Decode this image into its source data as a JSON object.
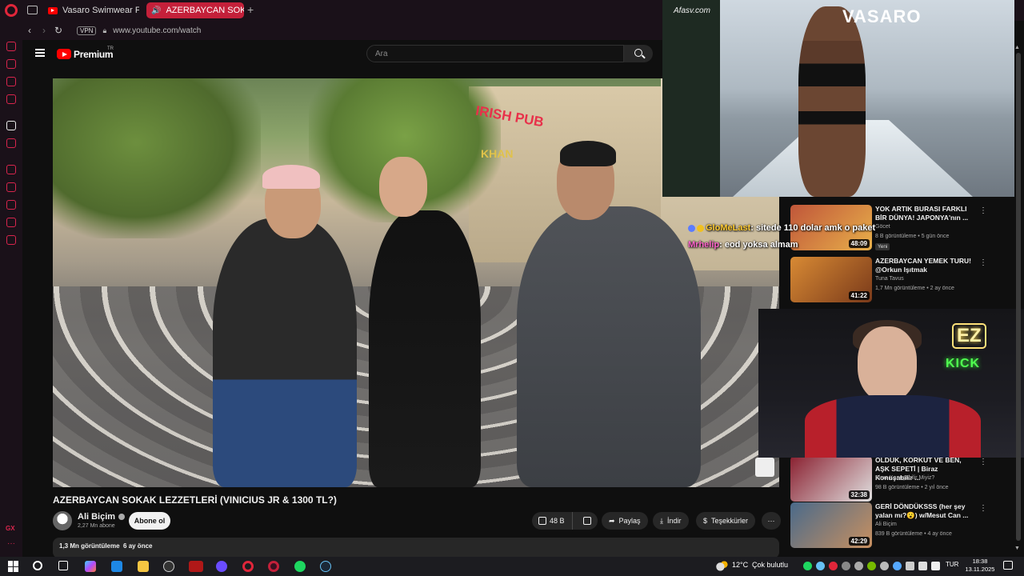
{
  "browser": {
    "tabs": [
      {
        "label": "Vasaro Swimwear Fashion"
      },
      {
        "label": "AZERBAYCAN SOKAK"
      }
    ],
    "vpn_label": "VPN",
    "url": "www.youtube.com/watch"
  },
  "youtube": {
    "brand": "Premium",
    "tm": "TR",
    "search_placeholder": "Ara"
  },
  "video": {
    "title": "AZERBAYCAN SOKAK LEZZETLERİ (VINICIUS JR & 1300 TL?)",
    "channel": "Ali Biçim",
    "subscribers": "2,27 Mn abone",
    "subscribe_label": "Abone ol",
    "likes": "48 B",
    "share_label": "Paylaş",
    "download_label": "İndir",
    "thanks_label": "Teşekkürler",
    "views": "1,3 Mn görüntüleme",
    "age": "6 ay önce",
    "scene_text": {
      "pub_sign": "IRISH PUB",
      "khan_sign": "KHAN"
    }
  },
  "recommendations": [
    {
      "title": "YOK ARTIK BURASI FARKLI BİR DÜNYA! JAPONYA'nın ...",
      "channel": "Göcet",
      "meta": "8 B görüntüleme • 5 gün önce",
      "badge": "Yeni",
      "duration": "48:09",
      "thumb_color": "#c0563a"
    },
    {
      "title": "AZERBAYCAN YEMEK TURU! @Orkun Işıtmak",
      "channel": "Tuna Tavus",
      "meta": "1,7 Mn görüntüleme • 2 ay önce",
      "duration": "41:22",
      "thumb_color": "#d88a34"
    },
    {
      "title": "ÖLDÜK, KORKUT VE BEN, AŞK SEPETİ | Biraz Konuşabilir ...",
      "channel": "Biraz Konuşabilir Miyiz?",
      "meta": "98 B görüntüleme • 2 yıl önce",
      "duration": "32:38",
      "thumb_color": "#8a2030"
    },
    {
      "title": "GERİ DÖNDÜKSSS (her şey yalan mı?😮) w/Mesut Can ...",
      "channel": "Ali Biçim",
      "meta": "839 B görüntüleme • 4 ay önce",
      "duration": "42:29",
      "thumb_color": "#4a6a8a"
    }
  ],
  "stream_overlay": {
    "runway_brand": "VASARO",
    "runway_watermark": "Afasv.com",
    "chat": [
      {
        "user": "GloMeLast",
        "message": ": sitede 110 dolar amk o paket"
      },
      {
        "user": "Mrhelip",
        "message": ": eod yoksa almam"
      }
    ],
    "webcam_sign1": "EZ",
    "webcam_sign2": "KICK"
  },
  "taskbar": {
    "temperature": "12°C",
    "weather": "Çok bulutlu",
    "language": "TUR",
    "time": "18:38",
    "date": "13.11.2025"
  },
  "colors": {
    "accent_red": "#ff0000",
    "opera_red": "#d9254d",
    "active_tab": "#c4203a"
  }
}
